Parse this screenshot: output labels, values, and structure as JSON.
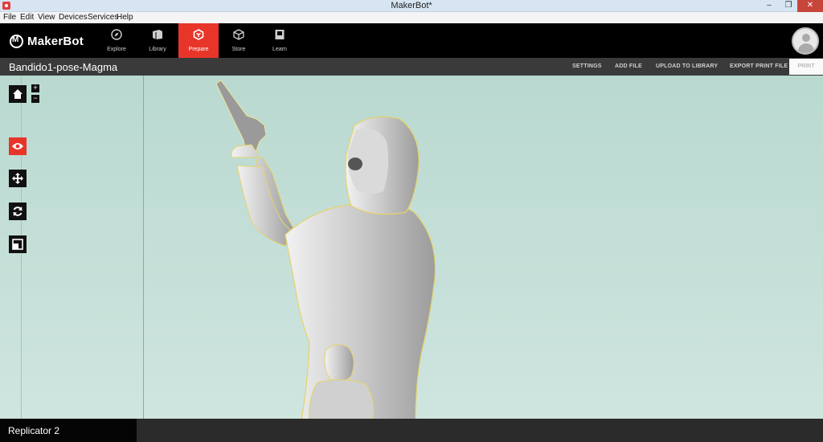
{
  "window": {
    "title": "MakerBot*"
  },
  "menu": [
    "File",
    "Edit",
    "View",
    "Devices",
    "Services",
    "Help"
  ],
  "brand": {
    "name": "MakerBot"
  },
  "nav": [
    {
      "label": "Explore",
      "icon": "compass-icon"
    },
    {
      "label": "Library",
      "icon": "library-icon"
    },
    {
      "label": "Prepare",
      "icon": "prepare-icon",
      "active": true
    },
    {
      "label": "Store",
      "icon": "store-icon"
    },
    {
      "label": "Learn",
      "icon": "learn-icon"
    }
  ],
  "file": {
    "name": "Bandido1-pose-Magma"
  },
  "actions": {
    "settings": "SETTINGS",
    "add_file": "ADD FILE",
    "upload": "UPLOAD TO LIBRARY",
    "export": "EXPORT PRINT FILE",
    "print": "PRINT"
  },
  "tools": {
    "zoom_in": "+",
    "zoom_out": "−",
    "active_tool": "view"
  },
  "status": {
    "printer": "Replicator 2"
  },
  "colors": {
    "accent": "#e8352a",
    "viewport": "#c9e2dc",
    "header": "#000000"
  }
}
